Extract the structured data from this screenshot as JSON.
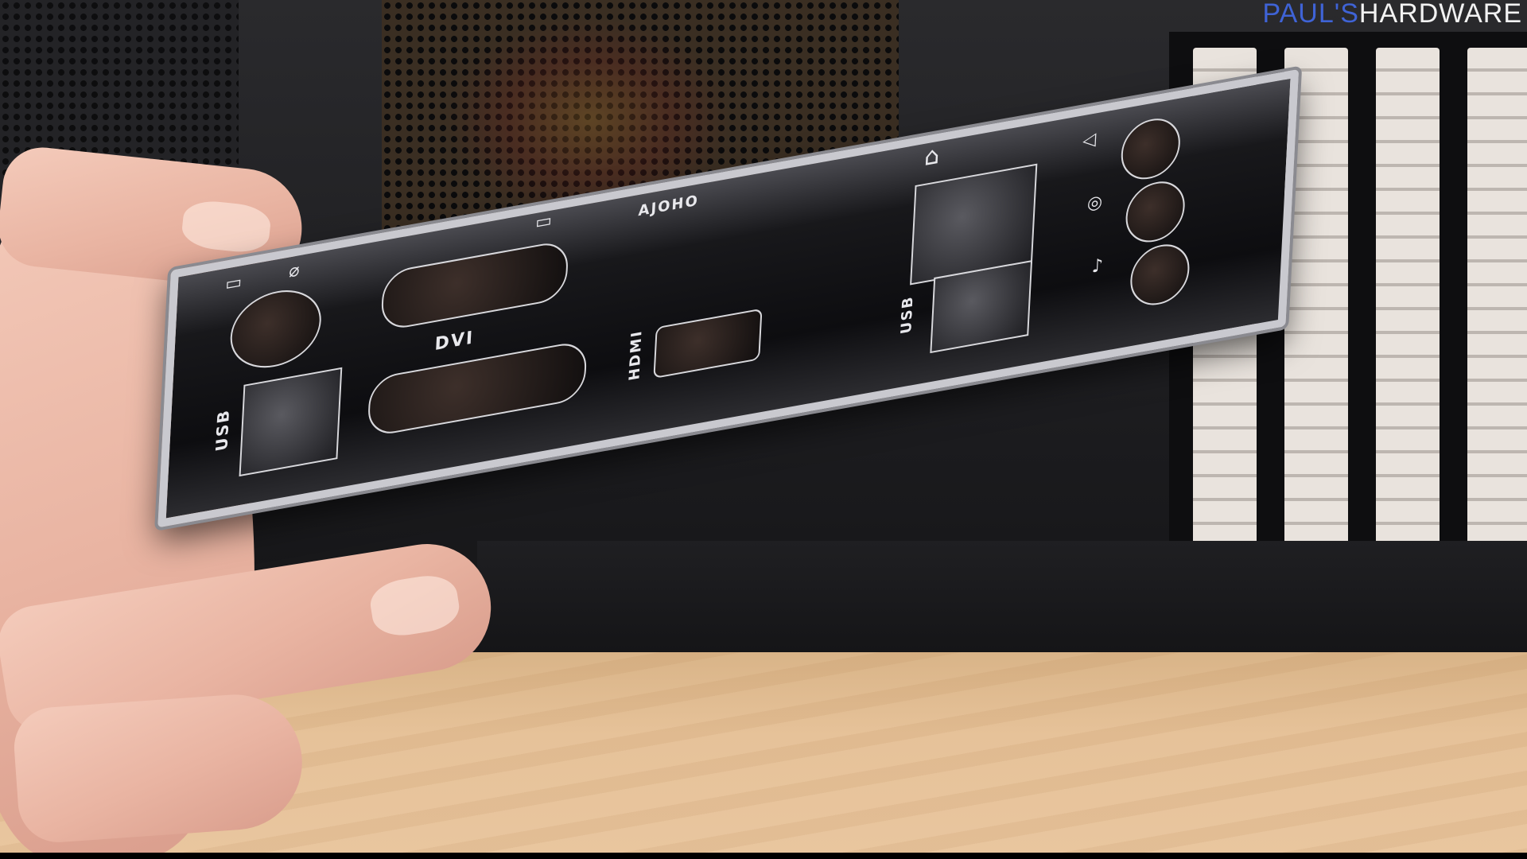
{
  "watermark": {
    "part1": "PAUL'S",
    "part2": "HARDWARE",
    "color1": "#3f63d6",
    "color2": "#f2f2f2"
  },
  "io_shield": {
    "brand_mark": "AJOHO",
    "labels": {
      "dvi": "DVI",
      "hdmi": "HDMI",
      "usb_left": "USB",
      "usb_right": "USB"
    },
    "icons": [
      "ps2-icon",
      "vga-icon",
      "lan-icon",
      "audio-in-icon",
      "audio-out-icon",
      "mic-icon",
      "usb-icon"
    ]
  },
  "scene": {
    "description_colors": {
      "desk": "#e6c299",
      "skin": "#e9b4a2",
      "shield_frame": "#c9c9cf"
    }
  }
}
